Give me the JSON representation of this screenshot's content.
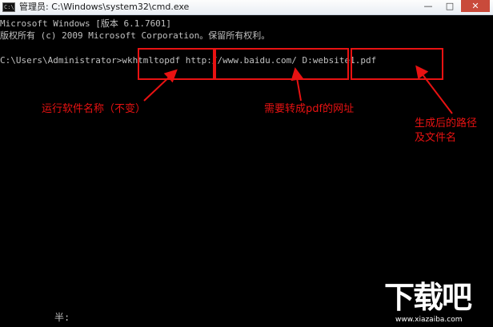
{
  "window": {
    "title": "管理员: C:\\Windows\\system32\\cmd.exe",
    "icon": "cmd-icon",
    "icon_glyph": "C:\\",
    "controls": {
      "minimize": "—",
      "maximize": "□",
      "close": "✕"
    }
  },
  "console": {
    "lines": [
      "Microsoft Windows [版本 6.1.7601]",
      "版权所有 (c) 2009 Microsoft Corporation。保留所有权利。",
      "",
      "C:\\Users\\Administrator>wkhtmltopdf http://www.baidu.com/ D:website1.pdf"
    ],
    "bottom_text": "半:"
  },
  "annotations": {
    "color": "#e81212",
    "notes": [
      "运行软件名称（不变）",
      "需要转成pdf的网址",
      "生成后的路径",
      "及文件名"
    ]
  },
  "watermark": {
    "logo_text": "下载吧",
    "url": "www.xiazaiba.com"
  }
}
